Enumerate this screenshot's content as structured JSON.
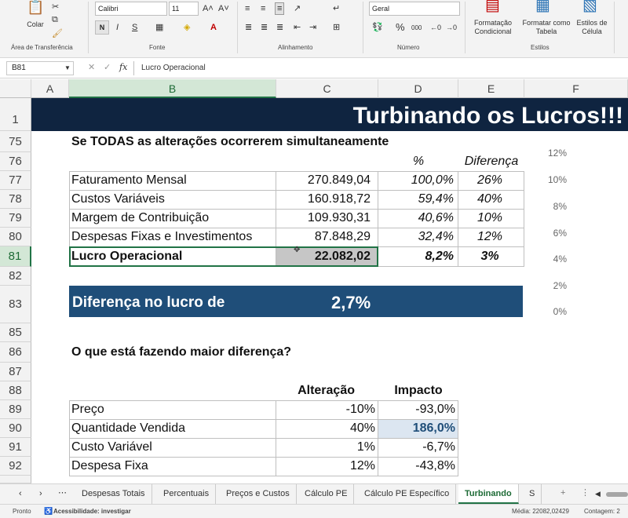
{
  "ribbon": {
    "colar_label": "Colar",
    "clipboard_group": "Área de Transferência",
    "font_name": "Calibri",
    "font_size": "11",
    "font_group": "Fonte",
    "alignment_group": "Alinhamento",
    "number_format": "Geral",
    "number_group": "Número",
    "cond_format_label1": "Formatação",
    "cond_format_label2": "Condicional",
    "format_table_label1": "Formatar como",
    "format_table_label2": "Tabela",
    "cell_styles_label1": "Estilos de",
    "cell_styles_label2": "Célula",
    "styles_group": "Estilos",
    "bold": "N",
    "italic": "I",
    "underline": "S",
    "percent": "%",
    "thousands": "000"
  },
  "formula_bar": {
    "cell_ref": "B81",
    "fx": "fx",
    "content": "Lucro Operacional"
  },
  "columns": [
    "A",
    "B",
    "C",
    "D",
    "E",
    "F"
  ],
  "rows": {
    "r1": "1",
    "r75": "75",
    "r76": "76",
    "r77": "77",
    "r78": "78",
    "r79": "79",
    "r80": "80",
    "r81": "81",
    "r82": "82",
    "r83": "83",
    "r85": "85",
    "r86": "86",
    "r87": "87",
    "r88": "88",
    "r89": "89",
    "r90": "90",
    "r91": "91",
    "r92": "92"
  },
  "sheet": {
    "banner_title": "Turbinando os Lucros!!!",
    "section_title": "Se TODAS as alterações ocorrerem simultaneamente",
    "hdr_pct": "%",
    "hdr_diff": "Diferença",
    "table": [
      {
        "label": "Faturamento Mensal",
        "value": "270.849,04",
        "pct": "100,0%",
        "diff": "26%"
      },
      {
        "label": "Custos Variáveis",
        "value": "160.918,72",
        "pct": "59,4%",
        "diff": "40%"
      },
      {
        "label": "Margem de Contribuição",
        "value": "109.930,31",
        "pct": "40,6%",
        "diff": "10%"
      },
      {
        "label": "Despesas Fixas e Investimentos",
        "value": "87.848,29",
        "pct": "32,4%",
        "diff": "12%"
      },
      {
        "label": "Lucro Operacional",
        "value": "22.082,02",
        "pct": "8,2%",
        "diff": "3%"
      }
    ],
    "profit_diff_label": "Diferença no lucro de",
    "profit_diff_value": "2,7%",
    "question": "O que está fazendo maior diferença?",
    "impact_hdr_change": "Alteração",
    "impact_hdr_impact": "Impacto",
    "impact_table": [
      {
        "label": "Preço",
        "change": "-10%",
        "impact": "-93,0%"
      },
      {
        "label": "Quantidade Vendida",
        "change": "40%",
        "impact": "186,0%"
      },
      {
        "label": "Custo Variável",
        "change": "1%",
        "impact": "-6,7%"
      },
      {
        "label": "Despesa Fixa",
        "change": "12%",
        "impact": "-43,8%"
      }
    ]
  },
  "chart_axis": [
    "12%",
    "10%",
    "8%",
    "6%",
    "4%",
    "2%",
    "0%"
  ],
  "tabs": [
    "Despesas Totais",
    "Percentuais",
    "Preços e Custos",
    "Cálculo PE",
    "Cálculo PE Específico",
    "Turbinando",
    "S"
  ],
  "status": {
    "ready": "Pronto",
    "accessibility": "Acessibilidade: investigar",
    "average": "Média: 22082,02429",
    "count": "Contagem: 2"
  },
  "colors": {
    "banner_bg": "#0f2440",
    "highlight_bar": "#1f4e79",
    "selected_cell": "#c6c6c6",
    "impact_highlight": "#dce6f1",
    "impact_highlight_text": "#1f4e79",
    "excel_green": "#217346"
  }
}
